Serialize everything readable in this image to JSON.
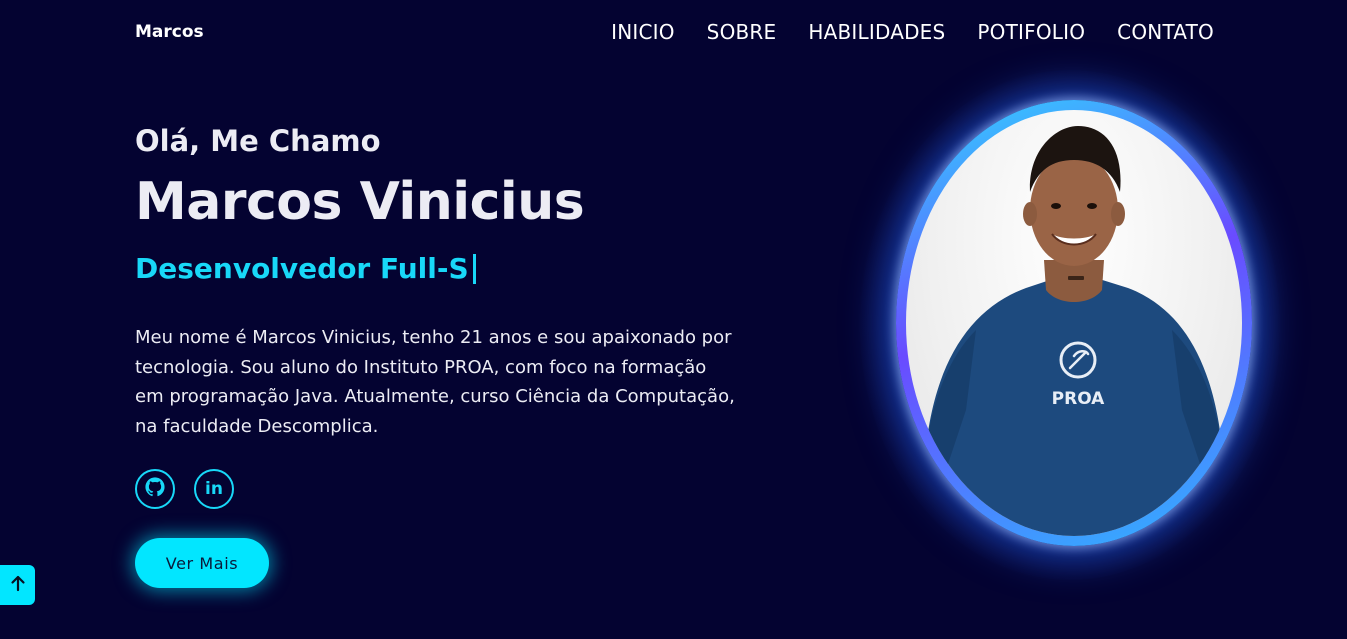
{
  "header": {
    "brand": "Marcos",
    "nav": [
      "INICIO",
      "SOBRE",
      "HABILIDADES",
      "POTIFOLIO",
      "CONTATO"
    ]
  },
  "hero": {
    "greeting": "Olá, Me Chamo",
    "name": "Marcos Vinicius",
    "role_typed": "Desenvolvedor Full-S",
    "bio": "Meu nome é Marcos Vinicius, tenho 21 anos e sou apaixonado por tecnologia. Sou aluno do Instituto PROA, com foco na formação em programação Java. Atualmente, curso Ciência da Computação, na faculdade Descomplica.",
    "cta_label": "Ver Mais"
  },
  "socials": [
    {
      "icon": "github-icon"
    },
    {
      "icon": "linkedin-icon",
      "glyph": "in"
    }
  ],
  "profile": {
    "shirt_logo": "PROA"
  },
  "colors": {
    "background": "#040331",
    "accent": "#02e6ff",
    "text": "#ececf4"
  }
}
